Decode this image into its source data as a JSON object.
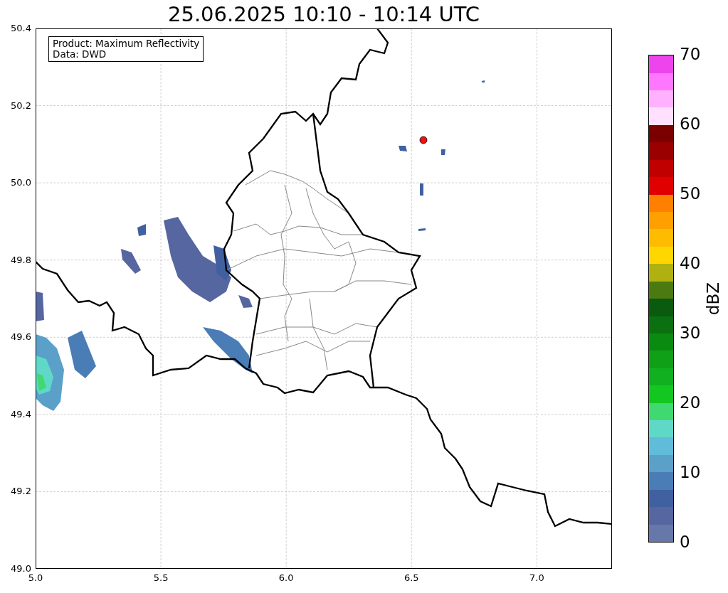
{
  "title": "25.06.2025 10:10 - 10:14 UTC",
  "info_box": {
    "lines": [
      "Product: Maximum Reflectivity",
      "Data: DWD"
    ]
  },
  "x_axis": {
    "ticks": [
      "5.0",
      "5.5",
      "6.0",
      "6.5",
      "7.0"
    ]
  },
  "y_axis": {
    "ticks": [
      "50.4",
      "50.2",
      "50.0",
      "49.8",
      "49.6",
      "49.4",
      "49.2",
      "49.0"
    ]
  },
  "colorbar": {
    "label": "dBZ",
    "ticks": [
      "70",
      "60",
      "50",
      "40",
      "30",
      "20",
      "10",
      "0"
    ],
    "bins": [
      {
        "color": "#6677aa"
      },
      {
        "color": "#5566a0"
      },
      {
        "color": "#4060a0"
      },
      {
        "color": "#4a7db5"
      },
      {
        "color": "#5aa0c8"
      },
      {
        "color": "#60bcd8"
      },
      {
        "color": "#60d8c8"
      },
      {
        "color": "#40d870"
      },
      {
        "color": "#12c820"
      },
      {
        "color": "#10b020"
      },
      {
        "color": "#10a018"
      },
      {
        "color": "#0a8a10"
      },
      {
        "color": "#0a7010"
      },
      {
        "color": "#0a5a10"
      },
      {
        "color": "#4a7a10"
      },
      {
        "color": "#b0b010"
      },
      {
        "color": "#ffd700"
      },
      {
        "color": "#ffbb00"
      },
      {
        "color": "#ff9f00"
      },
      {
        "color": "#ff8000"
      },
      {
        "color": "#e00000"
      },
      {
        "color": "#c00000"
      },
      {
        "color": "#9a0000"
      },
      {
        "color": "#7a0000"
      },
      {
        "color": "#ffe0ff"
      },
      {
        "color": "#ffb0ff"
      },
      {
        "color": "#ff77ff"
      },
      {
        "color": "#ee44ee"
      }
    ]
  }
}
